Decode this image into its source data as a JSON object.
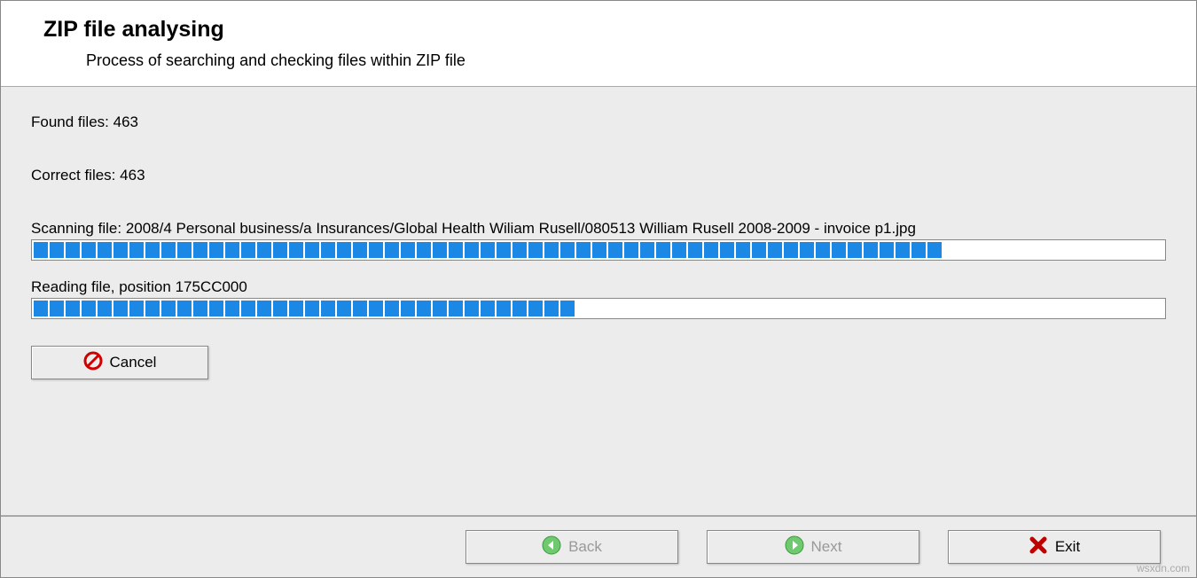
{
  "header": {
    "title": "ZIP file analysing",
    "subtitle": "Process of searching and checking files within ZIP file"
  },
  "status": {
    "found_label": "Found files:",
    "found_count": "463",
    "correct_label": "Correct files:",
    "correct_count": "463",
    "scanning_label": "Scanning file:",
    "scanning_path": "2008/4 Personal business/a Insurances/Global Health Wiliam Rusell/080513 William Rusell 2008-2009 - invoice p1.jpg",
    "reading_label": "Reading file, position",
    "reading_position": "175CC000"
  },
  "progress": {
    "scan_percent": 82,
    "read_percent": 48
  },
  "buttons": {
    "cancel": "Cancel",
    "back": "Back",
    "next": "Next",
    "exit": "Exit"
  },
  "watermark": "wsxdn.com"
}
